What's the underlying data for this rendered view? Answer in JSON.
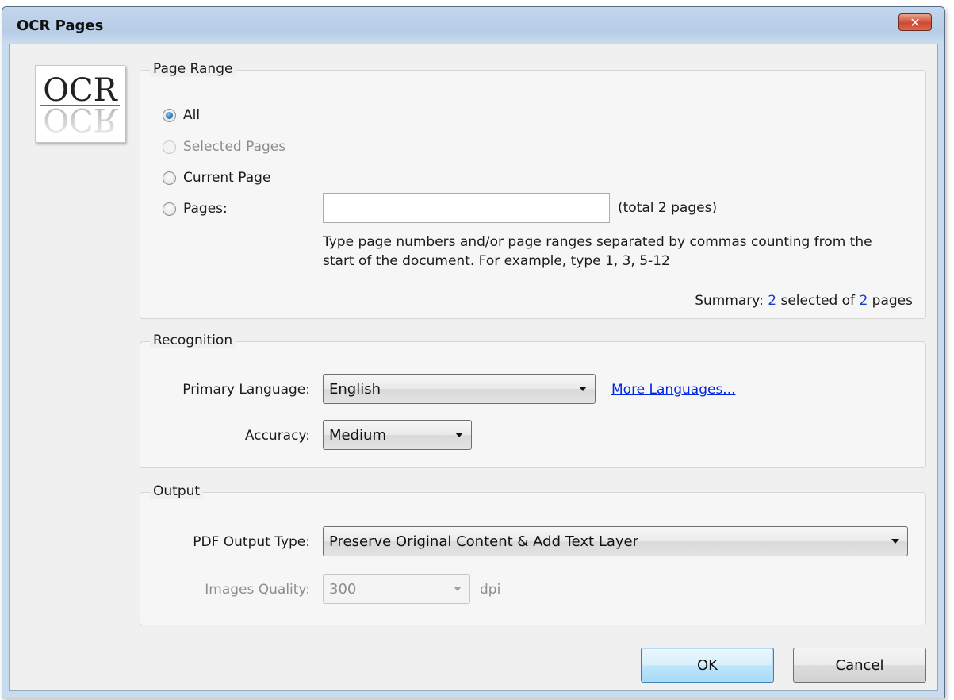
{
  "window": {
    "title": "OCR Pages",
    "close_icon": "close-icon"
  },
  "logo": {
    "icon": "ocr-logo-icon",
    "text": "OCR"
  },
  "page_range": {
    "label": "Page Range",
    "options": [
      {
        "label": "All",
        "checked": true,
        "enabled": true
      },
      {
        "label": "Selected Pages",
        "checked": false,
        "enabled": false
      },
      {
        "label": "Current Page",
        "checked": false,
        "enabled": true
      },
      {
        "label": "Pages:",
        "checked": false,
        "enabled": true
      }
    ],
    "pages_input_value": "",
    "total_text": "(total 2 pages)",
    "help_line1": "Type page numbers and/or page ranges separated by commas counting from the",
    "help_line2": "start of the document. For example, type 1, 3, 5-12",
    "summary_prefix": "Summary: ",
    "summary_selected": "2",
    "summary_middle": " selected of ",
    "summary_total": "2",
    "summary_suffix": " pages"
  },
  "recognition": {
    "label": "Recognition",
    "primary_language_label": "Primary Language:",
    "primary_language_value": "English",
    "more_languages_link": "More Languages...",
    "accuracy_label": "Accuracy:",
    "accuracy_value": "Medium"
  },
  "output": {
    "label": "Output",
    "pdf_output_type_label": "PDF Output Type:",
    "pdf_output_type_value": "Preserve Original Content & Add Text Layer",
    "images_quality_label": "Images Quality:",
    "images_quality_value": "300",
    "images_quality_unit": "dpi"
  },
  "buttons": {
    "ok": "OK",
    "cancel": "Cancel"
  },
  "colors": {
    "accent_blue": "#1d6fb5",
    "link": "#0026e6",
    "close_red": "#cc4a2f"
  }
}
